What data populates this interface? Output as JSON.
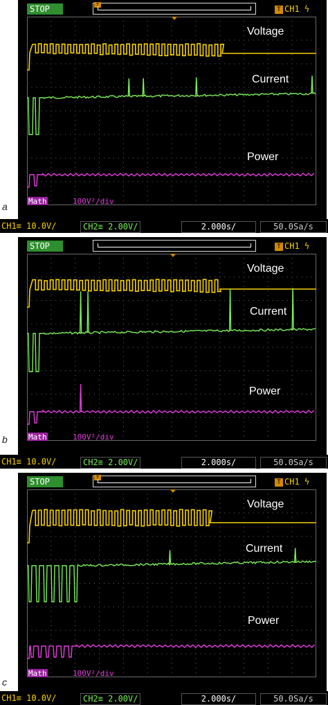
{
  "panels": [
    {
      "letter": "a",
      "status": "STOP",
      "trigger_channel": "CH1",
      "trigger_icon": "rising-edge-icon",
      "traces": {
        "voltage": "Voltage",
        "current": "Current",
        "power": "Power"
      },
      "math_label": "Math",
      "math_scale": "100V²/div",
      "ch1_scale": "CH1≡ 10.0V/",
      "ch2_scale": "CH2≡ 2.00V/",
      "timebase": "2.000s/",
      "sample_rate": "50.0Sa/s"
    },
    {
      "letter": "b",
      "status": "STOP",
      "trigger_channel": "CH1",
      "trigger_icon": "rising-edge-icon",
      "traces": {
        "voltage": "Voltage",
        "current": "Current",
        "power": "Power"
      },
      "math_label": "Math",
      "math_scale": "100V²/div",
      "ch1_scale": "CH1≡ 10.0V/",
      "ch2_scale": "CH2≡ 2.00V/",
      "timebase": "2.000s/",
      "sample_rate": "50.0Sa/s"
    },
    {
      "letter": "c",
      "status": "STOP",
      "trigger_channel": "CH1",
      "trigger_icon": "rising-edge-icon",
      "traces": {
        "voltage": "Voltage",
        "current": "Current",
        "power": "Power"
      },
      "math_label": "Math",
      "math_scale": "100V²/div",
      "ch1_scale": "CH1≡ 10.0V/",
      "ch2_scale": "CH2≡ 2.00V/",
      "timebase": "2.000s/",
      "sample_rate": "50.0Sa/s"
    }
  ],
  "colors": {
    "ch1": "#f7d100",
    "ch2": "#7cf05a",
    "math": "#e63de0",
    "grid": "#6a6a6a"
  },
  "chart_data": [
    {
      "type": "line",
      "panel": "a",
      "x_unit": "s",
      "x_divisions": 12,
      "series": [
        {
          "name": "Voltage",
          "pulse_until_div": 8.1,
          "spikes": []
        },
        {
          "name": "Current",
          "pulse_until_div": 0.6,
          "spikes": [
            4.2,
            4.8,
            7.0,
            11.8
          ]
        },
        {
          "name": "Power",
          "pulse_until_div": 0.6,
          "spikes": []
        }
      ]
    },
    {
      "type": "line",
      "panel": "b",
      "x_unit": "s",
      "x_divisions": 12,
      "series": [
        {
          "name": "Voltage",
          "pulse_until_div": 8.0,
          "spikes": []
        },
        {
          "name": "Current",
          "pulse_until_div": 0.6,
          "spikes": [
            2.2,
            2.5,
            8.4,
            11.0
          ]
        },
        {
          "name": "Power",
          "pulse_until_div": 0.6,
          "spikes": [
            2.2
          ]
        }
      ]
    },
    {
      "type": "line",
      "panel": "c",
      "x_unit": "s",
      "x_divisions": 12,
      "series": [
        {
          "name": "Voltage",
          "pulse_until_div": 7.6,
          "spikes": []
        },
        {
          "name": "Current",
          "pulse_until_div": 2.0,
          "spikes": [
            5.9,
            11.1
          ]
        },
        {
          "name": "Power",
          "pulse_until_div": 2.0,
          "spikes": []
        }
      ]
    }
  ]
}
